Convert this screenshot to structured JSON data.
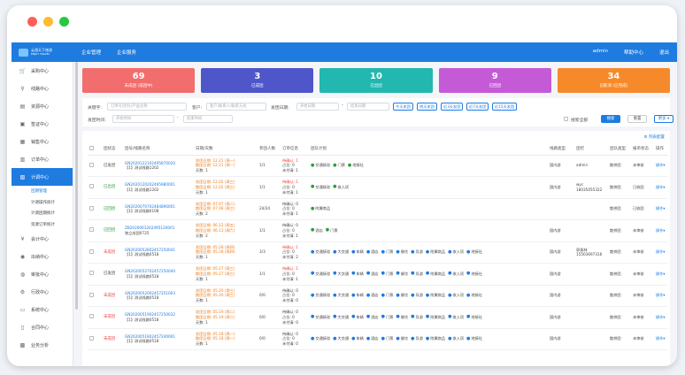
{
  "nav": {
    "logo_line1": "云游天下旅游",
    "logo_line2": "ENJOY TRAVEL",
    "items": [
      "企业管理",
      "企业服务"
    ],
    "right": [
      "admin",
      "帮助中心",
      "退出"
    ]
  },
  "sidebar": {
    "items": [
      {
        "label": "采购中心",
        "icon": "cart"
      },
      {
        "label": "线路中心",
        "icon": "map-pin"
      },
      {
        "label": "资源中心",
        "icon": "document"
      },
      {
        "label": "签证中心",
        "icon": "passport"
      },
      {
        "label": "销售中心",
        "icon": "chart"
      },
      {
        "label": "订单中心",
        "icon": "clipboard"
      },
      {
        "label": "计调中心",
        "icon": "schedule"
      }
    ],
    "subitems": [
      "团期管理",
      "计调操作统计",
      "计调团期统计",
      "资源订单统计"
    ],
    "items_after": [
      {
        "label": "会计中心",
        "icon": "currency"
      },
      {
        "label": "出纳中心",
        "icon": "cash"
      },
      {
        "label": "审批中心",
        "icon": "approve"
      },
      {
        "label": "行政中心",
        "icon": "gear"
      },
      {
        "label": "系统中心",
        "icon": "monitor"
      },
      {
        "label": "合同中心",
        "icon": "contract"
      },
      {
        "label": "业务分析",
        "icon": "analysis"
      }
    ]
  },
  "cards": [
    {
      "num": "69",
      "label": "未成团 (成团中)",
      "color": "#f26d6d"
    },
    {
      "num": "3",
      "label": "已成团",
      "color": "#4f56c9"
    },
    {
      "num": "10",
      "label": "已出团",
      "color": "#22b8b0"
    },
    {
      "num": "9",
      "label": "已回团",
      "color": "#c45ad6"
    },
    {
      "num": "34",
      "label": "已取消 (已完成)",
      "color": "#f68a2b"
    }
  ],
  "filters": {
    "keyword_label": "关键字:",
    "keyword_placeholder": "订单号/团号/产品名称",
    "customer_label": "客户:",
    "customer_placeholder": "客户/联系人/联系方式",
    "depart_label": "发团日期:",
    "start_placeholder": "开始日期",
    "end_placeholder": "结束日期",
    "quick": [
      "今天发团",
      "明天发团",
      "近3天发团",
      "近7天发团",
      "近15天发团"
    ],
    "issue_label": "发团时间:",
    "issue_start": "开始时间",
    "issue_end": "结束时间",
    "search_all": "搜索全部",
    "search": "搜索",
    "reset": "重置",
    "more": "更多"
  },
  "table": {
    "column_config": "列表配置",
    "headers": [
      "",
      "团状态",
      "团号/线路名称",
      "日期/天数",
      "参团人数",
      "订单信息",
      "团队计划",
      "线路类型",
      "团控",
      "团队类型",
      "报单状态",
      "操作"
    ],
    "rows": [
      {
        "status": "已发团",
        "status_class": "",
        "code": "GN2020122102495870020",
        "name": "【1】测试线路1202",
        "date_lines": [
          "发团日期: 12.21 (周一)",
          "散团日期: 12.21 (周一)",
          "天数: 1"
        ],
        "date_hl": "orange",
        "people": "1/1",
        "order": [
          "待确认: 1",
          "占位: 0",
          "未付清: 1"
        ],
        "plans": [
          [
            "g",
            "交通接驳"
          ],
          [
            "g",
            "门票"
          ],
          [
            "g",
            "地接社"
          ]
        ],
        "line_type": "国内游",
        "control": "admin",
        "team_type": "散拼团",
        "report": "未审核",
        "op": "操作"
      },
      {
        "status": "已出团",
        "status_class": "green",
        "code": "GN2020120202495980001",
        "name": "【1】测试线路1202",
        "date_lines": [
          "发团日期: 12.02 (周三)",
          "散团日期: 12.02 (周三)",
          "天数: 1"
        ],
        "date_hl": "orange",
        "people": "1/1",
        "order": [
          "待确认: 1",
          "占位: 0",
          "未付清: 1"
        ],
        "plans": [
          [
            "g",
            "交通接驳"
          ],
          [
            "g",
            "收入项"
          ]
        ],
        "line_type": "国内游",
        "control": "wyc\n18035055322",
        "team_type": "散拼团",
        "report": "已收团",
        "op": "操作"
      },
      {
        "status": "已回团",
        "status_class": "green",
        "code": "GN2020070702484890001",
        "name": "【1】测试线路0108",
        "date_lines": [
          "发团日期: 07.07 (周二)",
          "散团日期: 07.08 (周三)",
          "天数: 2"
        ],
        "date_hl": "orange",
        "people": "24/24",
        "order": [
          "待确认: 0",
          "占位: 0",
          "未付清: 1"
        ],
        "plans": [
          [
            "g",
            "附属商品"
          ]
        ],
        "line_type": "",
        "control": "",
        "team_type": "散拼团",
        "report": "已收团",
        "op": "操作"
      },
      {
        "status": "已回团",
        "status_class": "green",
        "code": "ZB2020061202495120001",
        "name": "独立成团0725",
        "date_lines": [
          "发团日期: 06.12 (周五)",
          "散团日期: 06.13 (周六)",
          "天数: 2"
        ],
        "date_hl": "orange",
        "people": "1/1",
        "order": [
          "待确认: 0",
          "占位: 0",
          "未付清: 1"
        ],
        "plans": [
          [
            "g",
            "酒店"
          ],
          [
            "g",
            "门票"
          ]
        ],
        "line_type": "国内游",
        "control": "",
        "team_type": "散拼团",
        "report": "未审核",
        "op": "操作"
      },
      {
        "status": "未成团",
        "status_class": "red",
        "code": "GN2020052802457250041",
        "name": "【1】测试线路0518",
        "date_lines": [
          "发团日期: 05.28 (周四)",
          "散团日期: 05.28 (周四)",
          "天数: 1"
        ],
        "date_hl": "orange",
        "people": "3/3",
        "order": [
          "待确认: 1",
          "占位: 0",
          "未付清: 2"
        ],
        "plans": [
          [
            "b",
            "交通接驳"
          ],
          [
            "b",
            "大交通"
          ],
          [
            "b",
            "车辆"
          ],
          [
            "b",
            "酒店"
          ],
          [
            "b",
            "门票"
          ],
          [
            "b",
            "餐饮"
          ],
          [
            "b",
            "导游"
          ],
          [
            "b",
            "附属商品"
          ],
          [
            "b",
            "收入项"
          ],
          [
            "b",
            "地接社"
          ]
        ],
        "line_type": "国内游",
        "control": "郭振林\n15503697316",
        "team_type": "散拼团",
        "report": "未审核",
        "op": "操作"
      },
      {
        "status": "已发团",
        "status_class": "",
        "code": "GN2020052702457250040",
        "name": "【1】测试线路0518",
        "date_lines": [
          "发团日期: 05.27 (周三)",
          "散团日期: 05.27 (周三)",
          "天数: 1"
        ],
        "date_hl": "orange",
        "people": "1/1",
        "order": [
          "待确认: 1",
          "占位: 0",
          "未付清: 1"
        ],
        "plans": [
          [
            "b",
            "交通接驳"
          ],
          [
            "b",
            "大交通"
          ],
          [
            "b",
            "车辆"
          ],
          [
            "b",
            "酒店"
          ],
          [
            "b",
            "门票"
          ],
          [
            "b",
            "餐饮"
          ],
          [
            "b",
            "导游"
          ],
          [
            "b",
            "附属商品"
          ],
          [
            "b",
            "收入项"
          ],
          [
            "b",
            "地接社"
          ]
        ],
        "line_type": "国内游",
        "control": "",
        "team_type": "散拼团",
        "report": "未审核",
        "op": "操作"
      },
      {
        "status": "未成团",
        "status_class": "red",
        "code": "GN2020052002457251003",
        "name": "【1】测试线路0518",
        "date_lines": [
          "发团日期: 05.20 (周三)",
          "散团日期: 05.20 (周三)",
          "天数: 1"
        ],
        "date_hl": "orange",
        "people": "0/0",
        "order": [
          "待确认: 0",
          "占位: 0",
          "未付清: 0"
        ],
        "plans": [
          [
            "b",
            "交通接驳"
          ],
          [
            "b",
            "大交通"
          ],
          [
            "b",
            "车辆"
          ],
          [
            "b",
            "酒店"
          ],
          [
            "b",
            "门票"
          ],
          [
            "b",
            "餐饮"
          ],
          [
            "b",
            "导游"
          ],
          [
            "b",
            "附属商品"
          ],
          [
            "b",
            "收入项"
          ],
          [
            "b",
            "地接社"
          ]
        ],
        "line_type": "国内游",
        "control": "",
        "team_type": "散拼团",
        "report": "未审核",
        "op": "操作"
      },
      {
        "status": "未成团",
        "status_class": "red",
        "code": "GN2020051902457250032",
        "name": "【1】测试线路0518",
        "date_lines": [
          "发团日期: 05.19 (周二)",
          "散团日期: 05.19 (周二)",
          "天数: 1"
        ],
        "date_hl": "orange",
        "people": "0/0",
        "order": [
          "待确认: 0",
          "占位: 0",
          "未付清: 0"
        ],
        "plans": [
          [
            "b",
            "交通接驳"
          ],
          [
            "b",
            "大交通"
          ],
          [
            "b",
            "车辆"
          ],
          [
            "b",
            "酒店"
          ],
          [
            "b",
            "门票"
          ],
          [
            "b",
            "餐饮"
          ],
          [
            "b",
            "导游"
          ],
          [
            "b",
            "附属商品"
          ],
          [
            "b",
            "收入项"
          ],
          [
            "b",
            "地接社"
          ]
        ],
        "line_type": "国内游",
        "control": "",
        "team_type": "散拼团",
        "report": "未审核",
        "op": "操作"
      },
      {
        "status": "未成团",
        "status_class": "red",
        "code": "GN2020051802457240001",
        "name": "【1】测试线路0518",
        "date_lines": [
          "发团日期: 05.18 (周一)",
          "散团日期: 05.18 (周一)",
          "天数: 1"
        ],
        "date_hl": "orange",
        "people": "0/0",
        "order": [
          "待确认: 0",
          "占位: 0",
          "未付清: 0"
        ],
        "plans": [
          [
            "b",
            "交通接驳"
          ],
          [
            "b",
            "大交通"
          ],
          [
            "b",
            "车辆"
          ],
          [
            "b",
            "酒店"
          ],
          [
            "b",
            "门票"
          ],
          [
            "b",
            "餐饮"
          ],
          [
            "b",
            "导游"
          ],
          [
            "b",
            "附属商品"
          ],
          [
            "b",
            "收入项"
          ],
          [
            "b",
            "地接社"
          ]
        ],
        "line_type": "国内游",
        "control": "",
        "team_type": "散拼团",
        "report": "未审核",
        "op": "操作"
      }
    ]
  },
  "colors": {
    "primary": "#1e7be0",
    "mac_red": "#ff5f57",
    "mac_yellow": "#febc2e",
    "mac_green": "#28c840"
  }
}
